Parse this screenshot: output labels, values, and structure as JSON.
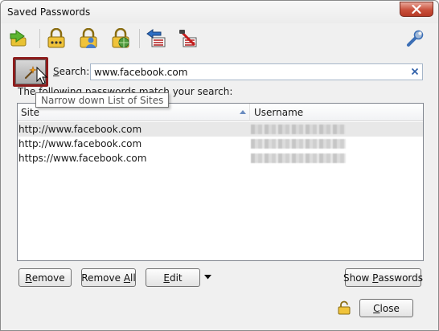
{
  "window": {
    "title": "Saved Passwords"
  },
  "toolbar": {
    "icons": [
      "import-export-icon",
      "password-lock-icon",
      "user-lock-icon",
      "site-lock-icon",
      "back-list-icon",
      "clear-list-icon",
      "settings-wrench-icon"
    ]
  },
  "search": {
    "label_prefix": "",
    "label_underlined": "S",
    "label_rest": "earch:",
    "value": "www.facebook.com",
    "filter_tooltip": "Narrow down List of Sites",
    "info_text": "The following passwords match your search:"
  },
  "table": {
    "columns": {
      "site": "Site",
      "username": "Username"
    },
    "rows": [
      {
        "site": "http://www.facebook.com",
        "selected": true
      },
      {
        "site": "http://www.facebook.com",
        "selected": false
      },
      {
        "site": "https://www.facebook.com",
        "selected": false
      }
    ]
  },
  "buttons": {
    "remove_u": "R",
    "remove_rest": "emove",
    "remove_all_pre": "Remove ",
    "remove_all_u": "A",
    "remove_all_rest": "ll",
    "edit_u": "E",
    "edit_rest": "dit",
    "show_pre": "Show ",
    "show_u": "P",
    "show_rest": "asswords",
    "close_u": "C",
    "close_rest": "lose"
  },
  "colors": {
    "accent_filter": "#8c1d1d",
    "close_button": "#c9503b",
    "selected_row": "#e8e8e8"
  }
}
